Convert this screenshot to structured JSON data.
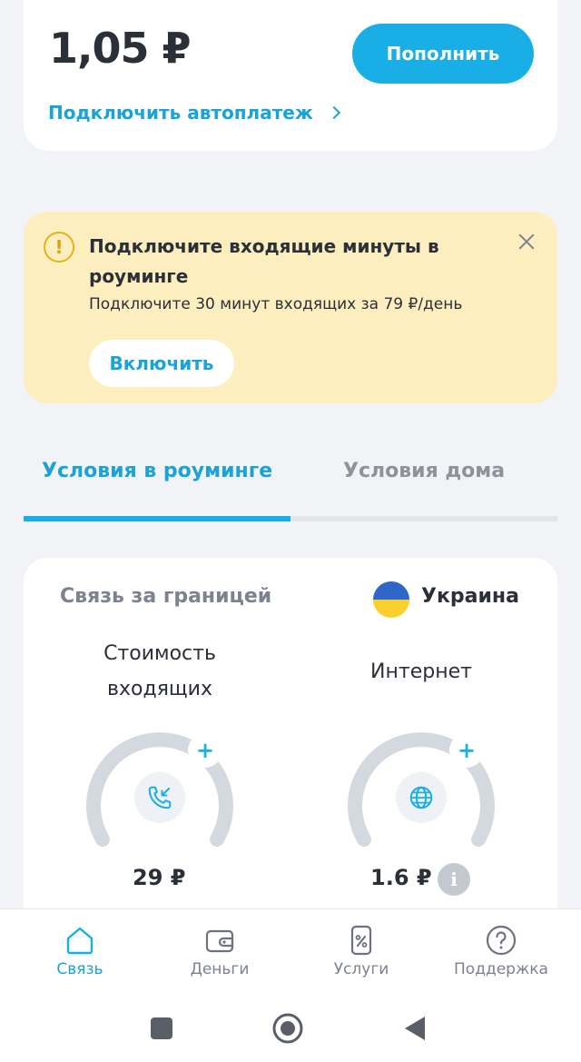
{
  "balance": {
    "amount": "1,05 ₽",
    "topup_label": "Пополнить",
    "autopay_label": "Подключить автоплатеж"
  },
  "notice": {
    "warning_glyph": "!",
    "title": "Подключите входящие минуты в роуминге",
    "text": "Подключите 30 минут входящих за 79 ₽/день",
    "enable_label": "Включить"
  },
  "tabs": [
    {
      "label": "Условия в роуминге",
      "active": true
    },
    {
      "label": "Условия дома",
      "active": false
    }
  ],
  "conditions": {
    "section_title": "Связь за границей",
    "country": "Украина",
    "gauges": [
      {
        "label": "Стоимость входящих",
        "icon": "incoming-call-icon",
        "price": "29 ₽",
        "plus": "+"
      },
      {
        "label": "Интернет",
        "icon": "globe-icon",
        "price": "1.6 ₽",
        "plus": "+"
      }
    ],
    "info_glyph": "i"
  },
  "bottom_nav": [
    {
      "label": "Связь",
      "icon": "home-icon",
      "active": true
    },
    {
      "label": "Деньги",
      "icon": "wallet-icon",
      "active": false
    },
    {
      "label": "Услуги",
      "icon": "services-icon",
      "active": false
    },
    {
      "label": "Поддержка",
      "icon": "help-icon",
      "active": false
    }
  ],
  "colors": {
    "accent": "#19aee6",
    "notice_bg": "#fdeebf",
    "warning": "#e5b21a",
    "flag_blue": "#2e67c7",
    "flag_yellow": "#f9d12c"
  }
}
